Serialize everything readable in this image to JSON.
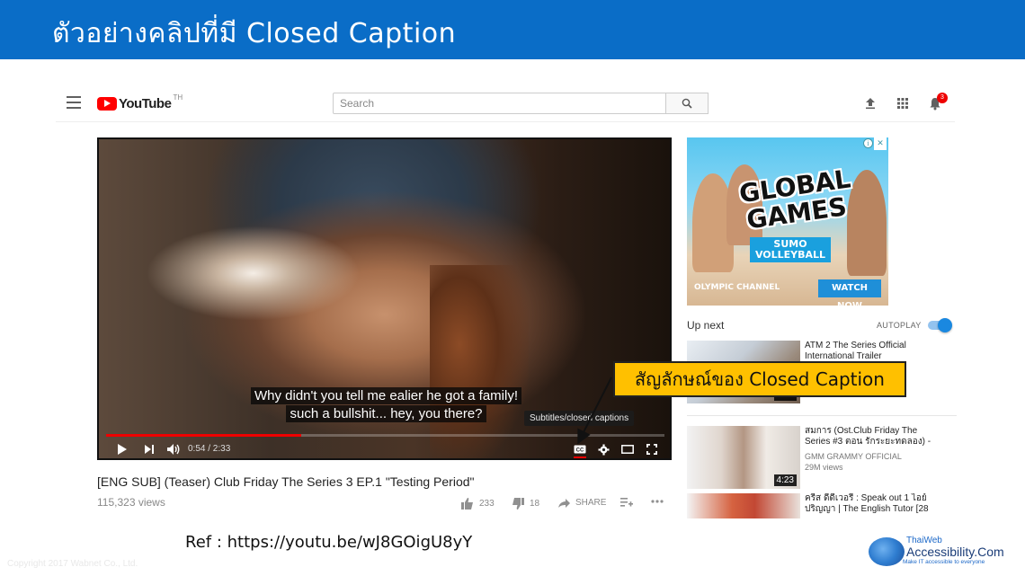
{
  "slide": {
    "title": "ตัวอย่างคลิปที่มี Closed Caption",
    "callout": "สัญลักษณ์ของ Closed Caption",
    "ref": "Ref : https://youtu.be/wJ8GOigU8yY",
    "copyright": "Copyright 2017 Wabnet Co., Ltd.",
    "logo": {
      "line1": "ThaiWeb",
      "line2": "Accessibility.Com",
      "tagline": "Make IT accessible to everyone"
    },
    "colors": {
      "title_bar": "#0a6dc7",
      "callout": "#ffc000",
      "yt_red": "#ff0000"
    }
  },
  "youtube": {
    "logo_text": "YouTube",
    "region": "TH",
    "search_placeholder": "Search",
    "notification_count": "3",
    "icons": [
      "menu-icon",
      "search-icon",
      "upload-icon",
      "apps-icon",
      "bell-icon"
    ]
  },
  "player": {
    "caption_line1": "Why didn't you tell me ealier he got a family!",
    "caption_line2": "such a bullshit... hey, you there?",
    "tooltip": "Subtitles/closed captions",
    "time": "0:54 / 2:33",
    "progress_played": 0.35,
    "progress_buffered": 0.35,
    "captions_on": true
  },
  "video": {
    "title": "[ENG SUB] (Teaser) Club Friday The Series 3 EP.1 \"Testing Period\"",
    "views": "115,323 views",
    "likes": "233",
    "dislikes": "18",
    "share": "SHARE"
  },
  "sidebar": {
    "ad": {
      "headline": "GLOBAL GAMES",
      "subhead": "SUMO VOLLEYBALL",
      "brand": "OLYMPIC CHANNEL",
      "cta": "WATCH NOW",
      "close": "✕",
      "info": "i"
    },
    "up_next": "Up next",
    "autoplay": "AUTOPLAY",
    "autoplay_on": true,
    "recommendations": [
      {
        "title": "ATM 2 The Series Official International Trailer",
        "channel": "",
        "views": "",
        "duration": "1:49"
      },
      {
        "title": "สมการ (Ost.Club Friday The Series #3 ตอน รักระยะทดลอง) -",
        "channel": "GMM GRAMMY OFFICIAL",
        "views": "29M views",
        "duration": "4:23"
      },
      {
        "title": "ครีส ดีดีเวอรี : Speak out 1 ไอย์ ปริญญา | The English Tutor [28",
        "channel": "",
        "views": "",
        "duration": ""
      }
    ]
  }
}
